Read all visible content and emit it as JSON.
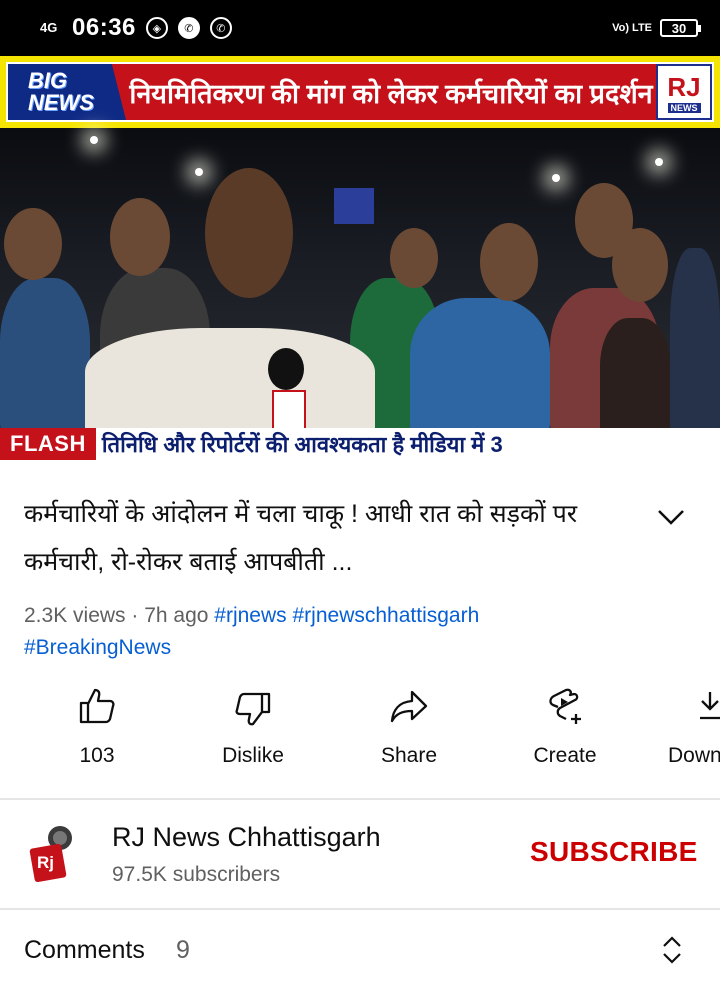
{
  "status_bar": {
    "network": "4G",
    "time": "06:36",
    "volte": "Vo) LTE",
    "battery": "30"
  },
  "video": {
    "banner_badge_line1": "BIG",
    "banner_badge_line2": "NEWS",
    "banner_headline": "नियमितिकरण की मांग को लेकर कर्मचारियों का प्रदर्शन",
    "channel_logo_text": "RJ",
    "channel_logo_sub": "NEWS",
    "flash_label": "FLASH",
    "flash_ticker": "तिनिधि और रिपोर्टरों की आवश्यकता है मीडिया में 3"
  },
  "title": "कर्मचारियों के आंदोलन में चला चाकू ! आधी रात को सड़कों पर कर्मचारी, रो-रोकर बताई आपबीती ...",
  "meta": {
    "views": "2.3K views · 7h ago",
    "tags": [
      "#rjnews",
      "#rjnewschhattisgarh",
      "#BreakingNews"
    ]
  },
  "actions": {
    "like": "103",
    "dislike": "Dislike",
    "share": "Share",
    "create": "Create",
    "download": "Down"
  },
  "channel": {
    "name": "RJ News Chhattisgarh",
    "subscribers": "97.5K subscribers",
    "subscribe_label": "SUBSCRIBE",
    "avatar_text": "Rj"
  },
  "comments": {
    "label": "Comments",
    "count": "9"
  },
  "colors": {
    "subscribe": "#cc0000",
    "hashtag": "#065fd4",
    "banner_red": "#c4111a",
    "banner_yellow": "#f5e400"
  }
}
